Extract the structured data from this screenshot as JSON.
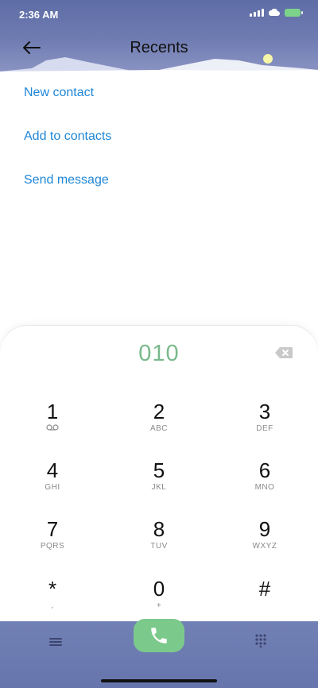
{
  "status_bar": {
    "time": "2:36 AM",
    "battery_color": "#7dd38a"
  },
  "header": {
    "title": "Recents",
    "back_icon": "arrow-left-icon"
  },
  "actions": [
    {
      "label": "New contact"
    },
    {
      "label": "Add to contacts"
    },
    {
      "label": "Send message"
    }
  ],
  "dialer": {
    "number": "010",
    "number_color": "#79b98c",
    "keys": [
      {
        "digit": "1",
        "letters": ""
      },
      {
        "digit": "2",
        "letters": "ABC"
      },
      {
        "digit": "3",
        "letters": "DEF"
      },
      {
        "digit": "4",
        "letters": "GHI"
      },
      {
        "digit": "5",
        "letters": "JKL"
      },
      {
        "digit": "6",
        "letters": "MNO"
      },
      {
        "digit": "7",
        "letters": "PQRS"
      },
      {
        "digit": "8",
        "letters": "TUV"
      },
      {
        "digit": "9",
        "letters": "WXYZ"
      },
      {
        "digit": "*",
        "letters": ","
      },
      {
        "digit": "0",
        "letters": "+"
      },
      {
        "digit": "#",
        "letters": ""
      }
    ]
  },
  "bottom_bar": {
    "menu_icon": "menu-icon",
    "call_icon": "phone-icon",
    "keypad_icon": "keypad-icon",
    "call_color": "#7cc98c"
  },
  "colors": {
    "accent": "#1f86d6",
    "header": "#6f7cb2"
  }
}
